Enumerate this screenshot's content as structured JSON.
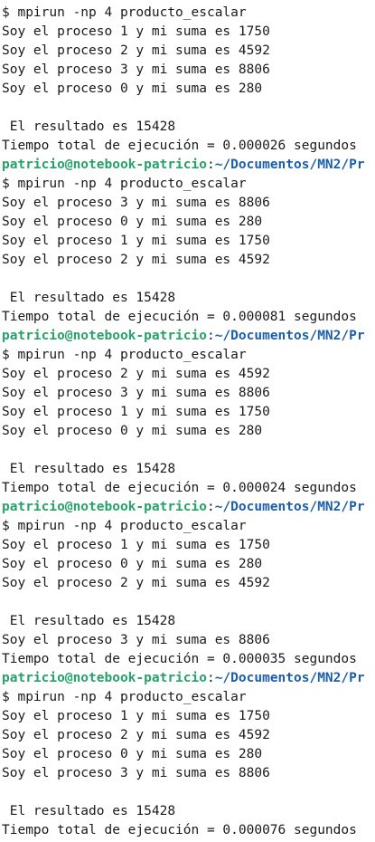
{
  "lines": [
    {
      "type": "text",
      "text": "$ mpirun -np 4 producto_escalar"
    },
    {
      "type": "text",
      "text": "Soy el proceso 1 y mi suma es 1750"
    },
    {
      "type": "text",
      "text": "Soy el proceso 2 y mi suma es 4592"
    },
    {
      "type": "text",
      "text": "Soy el proceso 3 y mi suma es 8806"
    },
    {
      "type": "text",
      "text": "Soy el proceso 0 y mi suma es 280"
    },
    {
      "type": "text",
      "text": ""
    },
    {
      "type": "text",
      "text": " El resultado es 15428"
    },
    {
      "type": "text",
      "text": "Tiempo total de ejecución = 0.000026 segundos"
    },
    {
      "type": "prompt",
      "user": "patricio@notebook-patricio",
      "sep": ":",
      "path": "~/Documentos/MN2/Pr"
    },
    {
      "type": "text",
      "text": "$ mpirun -np 4 producto_escalar"
    },
    {
      "type": "text",
      "text": "Soy el proceso 3 y mi suma es 8806"
    },
    {
      "type": "text",
      "text": "Soy el proceso 0 y mi suma es 280"
    },
    {
      "type": "text",
      "text": "Soy el proceso 1 y mi suma es 1750"
    },
    {
      "type": "text",
      "text": "Soy el proceso 2 y mi suma es 4592"
    },
    {
      "type": "text",
      "text": ""
    },
    {
      "type": "text",
      "text": " El resultado es 15428"
    },
    {
      "type": "text",
      "text": "Tiempo total de ejecución = 0.000081 segundos"
    },
    {
      "type": "prompt",
      "user": "patricio@notebook-patricio",
      "sep": ":",
      "path": "~/Documentos/MN2/Pr"
    },
    {
      "type": "text",
      "text": "$ mpirun -np 4 producto_escalar"
    },
    {
      "type": "text",
      "text": "Soy el proceso 2 y mi suma es 4592"
    },
    {
      "type": "text",
      "text": "Soy el proceso 3 y mi suma es 8806"
    },
    {
      "type": "text",
      "text": "Soy el proceso 1 y mi suma es 1750"
    },
    {
      "type": "text",
      "text": "Soy el proceso 0 y mi suma es 280"
    },
    {
      "type": "text",
      "text": ""
    },
    {
      "type": "text",
      "text": " El resultado es 15428"
    },
    {
      "type": "text",
      "text": "Tiempo total de ejecución = 0.000024 segundos"
    },
    {
      "type": "prompt",
      "user": "patricio@notebook-patricio",
      "sep": ":",
      "path": "~/Documentos/MN2/Pr"
    },
    {
      "type": "text",
      "text": "$ mpirun -np 4 producto_escalar"
    },
    {
      "type": "text",
      "text": "Soy el proceso 1 y mi suma es 1750"
    },
    {
      "type": "text",
      "text": "Soy el proceso 0 y mi suma es 280"
    },
    {
      "type": "text",
      "text": "Soy el proceso 2 y mi suma es 4592"
    },
    {
      "type": "text",
      "text": ""
    },
    {
      "type": "text",
      "text": " El resultado es 15428"
    },
    {
      "type": "text",
      "text": "Soy el proceso 3 y mi suma es 8806"
    },
    {
      "type": "text",
      "text": "Tiempo total de ejecución = 0.000035 segundos"
    },
    {
      "type": "prompt",
      "user": "patricio@notebook-patricio",
      "sep": ":",
      "path": "~/Documentos/MN2/Pr"
    },
    {
      "type": "text",
      "text": "$ mpirun -np 4 producto_escalar"
    },
    {
      "type": "text",
      "text": "Soy el proceso 1 y mi suma es 1750"
    },
    {
      "type": "text",
      "text": "Soy el proceso 2 y mi suma es 4592"
    },
    {
      "type": "text",
      "text": "Soy el proceso 0 y mi suma es 280"
    },
    {
      "type": "text",
      "text": "Soy el proceso 3 y mi suma es 8806"
    },
    {
      "type": "text",
      "text": ""
    },
    {
      "type": "text",
      "text": " El resultado es 15428"
    },
    {
      "type": "text",
      "text": "Tiempo total de ejecución = 0.000076 segundos"
    }
  ],
  "colors": {
    "background": "#ffffff",
    "text": "#1a1a1a",
    "prompt_user": "#26a269",
    "prompt_path": "#1c5ea8"
  }
}
